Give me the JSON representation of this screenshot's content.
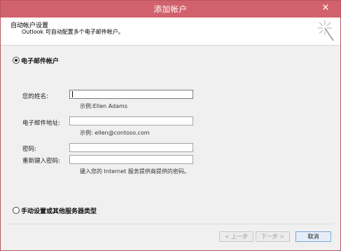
{
  "window": {
    "title": "添加帐户",
    "close_glyph": "✕"
  },
  "header": {
    "title": "自动帐户设置",
    "subtitle": "Outlook 可自动配置多个电子邮件帐户。",
    "icon": "magic-wand-icon"
  },
  "options": {
    "email_account": {
      "label": "电子邮件帐户",
      "selected": true
    },
    "manual": {
      "label": "手动设置或其他服务器类型",
      "selected": false
    }
  },
  "form": {
    "name": {
      "label": "您的姓名:",
      "value": "",
      "hint": "示例:Ellen Adams"
    },
    "email": {
      "label": "电子邮件地址:",
      "value": "",
      "hint": "示例: ellen@contoso.com"
    },
    "password": {
      "label": "密码:",
      "value": ""
    },
    "password_confirm": {
      "label": "重新键入密码:",
      "value": "",
      "hint": "键入您的 Internet 服务提供商提供的密码。"
    }
  },
  "buttons": {
    "back": {
      "label": "< 上一步",
      "enabled": false
    },
    "next": {
      "label": "下一步 >",
      "enabled": false
    },
    "cancel": {
      "label": "取消",
      "enabled": true
    }
  },
  "colors": {
    "titlebar": "#d1626d",
    "dialog_bg": "#f0f0f0",
    "header_bg": "#ffffff"
  }
}
